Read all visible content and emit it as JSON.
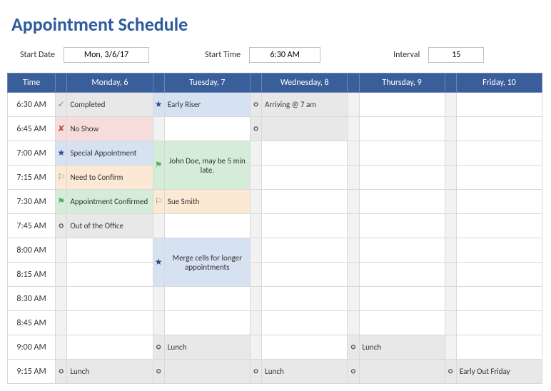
{
  "title": "Appointment Schedule",
  "controls": {
    "start_date_label": "Start Date",
    "start_date_value": "Mon, 3/6/17",
    "start_time_label": "Start Time",
    "start_time_value": "6:30 AM",
    "interval_label": "Interval",
    "interval_value": "15"
  },
  "headers": {
    "time": "Time",
    "days": [
      "Monday, 6",
      "Tuesday, 7",
      "Wednesday, 8",
      "Thursday, 9",
      "Friday, 10"
    ]
  },
  "times": [
    "6:30 AM",
    "6:45 AM",
    "7:00 AM",
    "7:15 AM",
    "7:30 AM",
    "7:45 AM",
    "8:00 AM",
    "8:15 AM",
    "8:30 AM",
    "8:45 AM",
    "9:00 AM",
    "9:15 AM"
  ],
  "cells": {
    "mon": {
      "r0": {
        "icon": "check",
        "text": "Completed",
        "fill": "gray",
        "txt": "gray"
      },
      "r1": {
        "icon": "xmark",
        "text": "No Show",
        "fill": "red",
        "txt": "red"
      },
      "r2": {
        "icon": "star",
        "text": "Special Appointment",
        "fill": "blue",
        "txt": "blue"
      },
      "r3": {
        "icon": "flag-white",
        "text": "Need to Confirm",
        "fill": "orange"
      },
      "r4": {
        "icon": "flag-green",
        "text": "Appointment Confirmed",
        "fill": "green",
        "txt": "green"
      },
      "r5": {
        "icon": "ring",
        "text": "Out of the Office",
        "fill": "gray"
      },
      "r11": {
        "icon": "ring",
        "text": "Lunch",
        "fill": "gray"
      }
    },
    "tue": {
      "r0": {
        "icon": "star",
        "text": "Early Riser",
        "fill": "blue",
        "txt": "blue"
      },
      "r2_3": {
        "icon": "flag-green",
        "text": "John Doe, may be 5 min late.",
        "fill": "green",
        "txt": "green"
      },
      "r4": {
        "icon": "flag-white",
        "text": "Sue Smith",
        "fill": "orange"
      },
      "r6_7": {
        "icon": "star",
        "text": "Merge cells for longer appointments",
        "fill": "blue",
        "txt": "blue"
      },
      "r10": {
        "icon": "ring",
        "text": "Lunch",
        "fill": "gray"
      },
      "r11": {
        "icon": "ring",
        "text": "",
        "fill": "gray"
      }
    },
    "wed": {
      "r0": {
        "icon": "ring",
        "text": "Arriving @ 7 am",
        "fill": "gray"
      },
      "r1": {
        "icon": "ring",
        "text": "",
        "fill": "gray"
      },
      "r11": {
        "icon": "ring",
        "text": "Lunch",
        "fill": "gray"
      }
    },
    "thu": {
      "r10": {
        "icon": "ring",
        "text": "Lunch",
        "fill": "gray"
      },
      "r11": {
        "icon": "ring",
        "text": "",
        "fill": "gray"
      }
    },
    "fri": {
      "r11": {
        "icon": "ring",
        "text": "Early Out Friday",
        "fill": "gray"
      }
    }
  }
}
